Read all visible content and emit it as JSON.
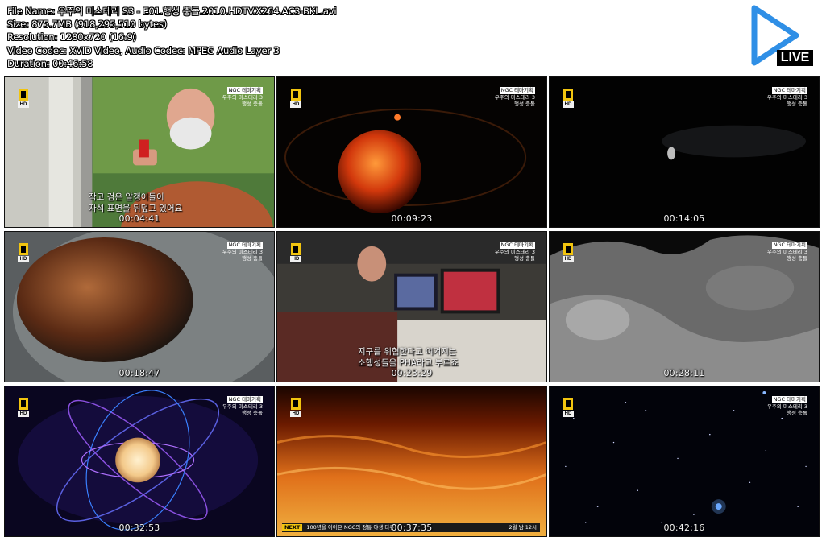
{
  "info": {
    "file_name": "File Name: 우주의 미스테리 S3 - E01.행성 충돌.2010.HDTV.X264.AC3-BKL.avi",
    "size": "Size: 875.7MB (918,295,510 bytes)",
    "resolution": "Resolution: 1280x720 (16:9)",
    "codec": "Video Codec: XVID Video, Audio Codec: MPEG Audio Layer 3",
    "duration": "Duration: 00:46:58"
  },
  "logo": {
    "label": "LIVE",
    "icon": "play-triangle-icon",
    "color": "#2f8fe6"
  },
  "overlay": {
    "hd": "HD",
    "tag": "NGC 테마기획",
    "series": "우주의 미스테리 3",
    "episode": "행성 충돌"
  },
  "thumbs": [
    {
      "time": "00:04:41",
      "sub1": "작고 검은 알갱이들이",
      "sub2": "자석 표면을 뒤덮고 있어요",
      "brand": true
    },
    {
      "time": "00:09:23",
      "brand": true
    },
    {
      "time": "00:14:05",
      "brand": true
    },
    {
      "time": "00:18:47",
      "brand": true
    },
    {
      "time": "00:23:29",
      "sub1": "지구를 위협한다고 여겨지는",
      "sub2": "소행성들을 PHA라고 부르죠",
      "brand": true
    },
    {
      "time": "00:28:11",
      "brand": true
    },
    {
      "time": "00:32:53",
      "brand": true
    },
    {
      "time": "00:37:35",
      "ticker_next": "NEXT",
      "ticker_text": "100년을 이어온 NGC의 정통 야생 다큐!",
      "ticker_right": "2월 밤 12시",
      "brand": false
    },
    {
      "time": "00:42:16",
      "brand": true
    }
  ]
}
